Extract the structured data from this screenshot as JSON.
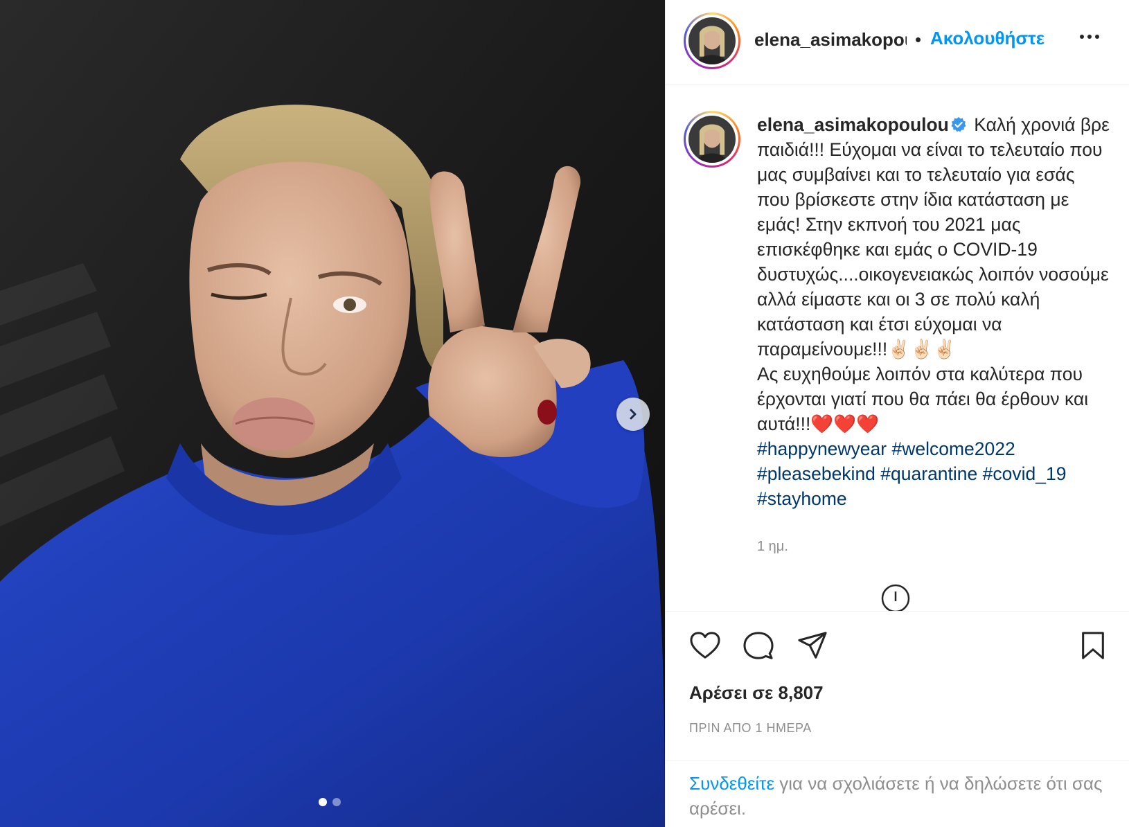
{
  "media": {
    "image_alt": "selfie photo",
    "next_icon": "chevron-right-icon",
    "carousel": {
      "count": 2,
      "active_index": 0
    }
  },
  "header": {
    "username": "elena_asimakopoulou",
    "separator": "•",
    "follow_label": "Ακολουθήστε",
    "more_icon": "more-horizontal-icon"
  },
  "caption": {
    "username": "elena_asimakopoulou",
    "verified_icon": "verified-badge-icon",
    "text": "Καλή χρονιά βρε παιδιά!!! Εύχομαι να είναι το τελευταίο που μας συμβαίνει και το τελευταίο για εσάς που βρίσκεστε στην ίδια κατάσταση με εμάς! Στην εκπνοή του 2021 μας επισκέφθηκε και εμάς ο COVID-19 δυστυχώς....οικογενειακώς λοιπόν νοσούμε αλλά είμαστε και οι 3 σε πολύ καλή κατάσταση και έτσι εύχομαι να παραμείνουμε!!!✌🏻✌🏻✌🏻",
    "text2": "Ας ευχηθούμε λοιπόν στα καλύτερα που έρχονται γιατί που θα πάει θα έρθουν και αυτά!!!❤️❤️❤️",
    "hashtags": [
      "#happynewyear",
      "#welcome2022",
      "#pleasebekind",
      "#quarantine",
      "#covid_19",
      "#stayhome"
    ],
    "time_ago": "1 ημ."
  },
  "actions": {
    "like_icon": "heart-icon",
    "comment_icon": "comment-icon",
    "share_icon": "send-icon",
    "save_icon": "bookmark-icon",
    "likes_text": "Αρέσει σε 8,807",
    "date_text": "ΠΡΙΝ ΑΠΟ 1 ΗΜΕΡΑ"
  },
  "footer": {
    "login_link": "Συνδεθείτε",
    "rest_text": " για να σχολιάσετε ή να δηλώσετε ότι σας αρέσει."
  },
  "colors": {
    "accent": "#0095f6",
    "hashtag": "#00376b",
    "muted": "#8e8e8e",
    "sweater_blue": "#1f3fb8"
  }
}
